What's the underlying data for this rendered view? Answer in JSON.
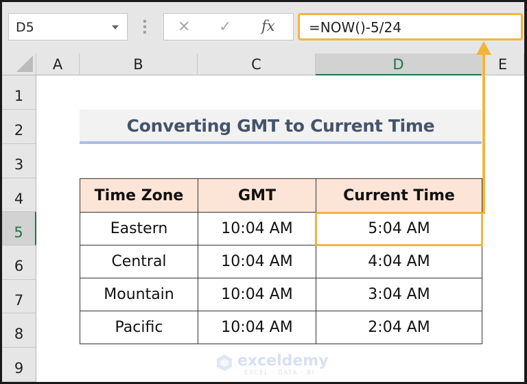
{
  "formula_bar": {
    "name_box": "D5",
    "cancel_icon": "✕",
    "enter_icon": "✓",
    "fx_label": "fx",
    "formula": "=NOW()-5/24"
  },
  "columns": [
    "A",
    "B",
    "C",
    "D",
    "E"
  ],
  "selected_column": "D",
  "rows": [
    "1",
    "2",
    "3",
    "4",
    "5",
    "6",
    "7",
    "8",
    "9"
  ],
  "selected_row": "5",
  "sheet": {
    "title": "Converting GMT to Current Time",
    "table": {
      "headers": [
        "Time Zone",
        "GMT",
        "Current Time"
      ],
      "rows": [
        [
          "Eastern",
          "10:04 AM",
          "5:04 AM"
        ],
        [
          "Central",
          "10:04 AM",
          "4:04 AM"
        ],
        [
          "Mountain",
          "10:04 AM",
          "3:04 AM"
        ],
        [
          "Pacific",
          "10:04 AM",
          "2:04 AM"
        ]
      ]
    }
  },
  "colors": {
    "highlight": "#f4b43c",
    "header_fill": "#fce4d6",
    "title_text": "#44546a",
    "title_underline": "#a9bfe4",
    "excel_green": "#217346"
  },
  "watermark": {
    "name": "exceldemy",
    "tagline": "EXCEL · DATA · BI"
  }
}
